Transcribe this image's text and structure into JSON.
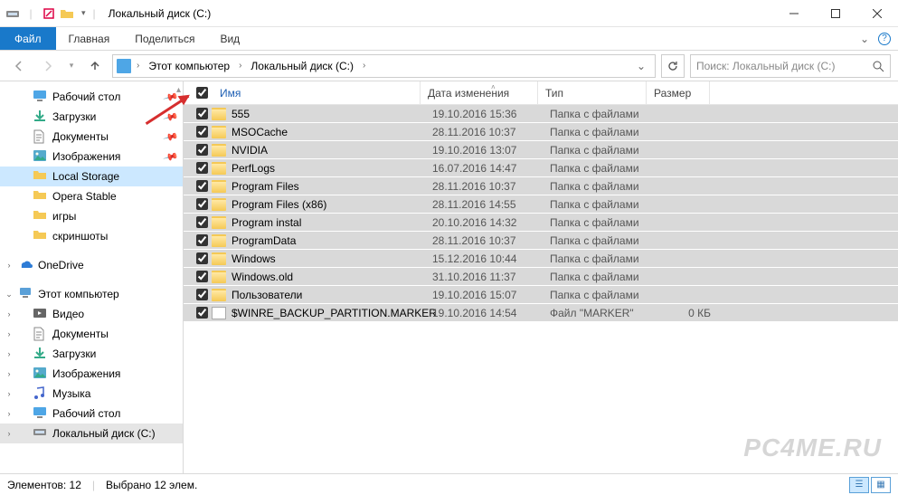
{
  "window": {
    "title": "Локальный диск (C:)"
  },
  "ribbon": {
    "file": "Файл",
    "tabs": [
      "Главная",
      "Поделиться",
      "Вид"
    ]
  },
  "breadcrumb": {
    "items": [
      "Этот компьютер",
      "Локальный диск (C:)"
    ]
  },
  "search": {
    "placeholder": "Поиск: Локальный диск (C:)"
  },
  "columns": {
    "name": "Имя",
    "date": "Дата изменения",
    "type": "Тип",
    "size": "Размер"
  },
  "sidebar": {
    "quick": [
      {
        "label": "Рабочий стол",
        "icon": "desktop",
        "pinned": true
      },
      {
        "label": "Загрузки",
        "icon": "downloads",
        "pinned": true
      },
      {
        "label": "Документы",
        "icon": "documents",
        "pinned": true
      },
      {
        "label": "Изображения",
        "icon": "pictures",
        "pinned": true
      },
      {
        "label": "Local Storage",
        "icon": "folder",
        "pinned": false,
        "selected": true
      },
      {
        "label": "Opera Stable",
        "icon": "folder",
        "pinned": false
      },
      {
        "label": "игры",
        "icon": "folder",
        "pinned": false
      },
      {
        "label": "скриншоты",
        "icon": "folder",
        "pinned": false
      }
    ],
    "onedrive": {
      "label": "OneDrive"
    },
    "thispc": {
      "label": "Этот компьютер",
      "children": [
        {
          "label": "Видео",
          "icon": "video"
        },
        {
          "label": "Документы",
          "icon": "documents"
        },
        {
          "label": "Загрузки",
          "icon": "downloads"
        },
        {
          "label": "Изображения",
          "icon": "pictures"
        },
        {
          "label": "Музыка",
          "icon": "music"
        },
        {
          "label": "Рабочий стол",
          "icon": "desktop"
        },
        {
          "label": "Локальный диск (C:)",
          "icon": "drive",
          "selected_bg": true
        }
      ]
    }
  },
  "files": [
    {
      "name": "555",
      "date": "19.10.2016 15:36",
      "type": "Папка с файлами",
      "size": "",
      "kind": "folder"
    },
    {
      "name": "MSOCache",
      "date": "28.11.2016 10:37",
      "type": "Папка с файлами",
      "size": "",
      "kind": "folder"
    },
    {
      "name": "NVIDIA",
      "date": "19.10.2016 13:07",
      "type": "Папка с файлами",
      "size": "",
      "kind": "folder"
    },
    {
      "name": "PerfLogs",
      "date": "16.07.2016 14:47",
      "type": "Папка с файлами",
      "size": "",
      "kind": "folder"
    },
    {
      "name": "Program Files",
      "date": "28.11.2016 10:37",
      "type": "Папка с файлами",
      "size": "",
      "kind": "folder"
    },
    {
      "name": "Program Files (x86)",
      "date": "28.11.2016 14:55",
      "type": "Папка с файлами",
      "size": "",
      "kind": "folder"
    },
    {
      "name": "Program instal",
      "date": "20.10.2016 14:32",
      "type": "Папка с файлами",
      "size": "",
      "kind": "folder"
    },
    {
      "name": "ProgramData",
      "date": "28.11.2016 10:37",
      "type": "Папка с файлами",
      "size": "",
      "kind": "folder"
    },
    {
      "name": "Windows",
      "date": "15.12.2016 10:44",
      "type": "Папка с файлами",
      "size": "",
      "kind": "folder"
    },
    {
      "name": "Windows.old",
      "date": "31.10.2016 11:37",
      "type": "Папка с файлами",
      "size": "",
      "kind": "folder"
    },
    {
      "name": "Пользователи",
      "date": "19.10.2016 15:07",
      "type": "Папка с файлами",
      "size": "",
      "kind": "folder"
    },
    {
      "name": "$WINRE_BACKUP_PARTITION.MARKER",
      "date": "19.10.2016 14:54",
      "type": "Файл \"MARKER\"",
      "size": "0 КБ",
      "kind": "file"
    }
  ],
  "status": {
    "count": "Элементов: 12",
    "selected": "Выбрано 12 элем."
  },
  "watermark": "PC4ME.RU"
}
